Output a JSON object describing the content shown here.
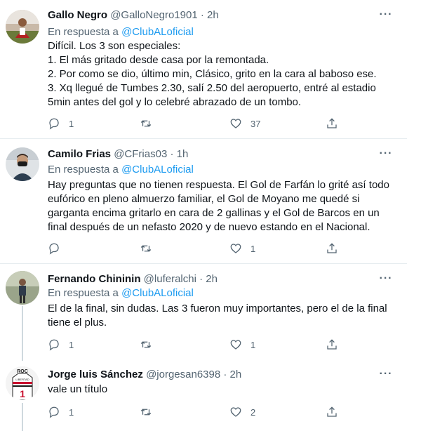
{
  "tweets": [
    {
      "name": "Gallo Negro",
      "handle": "@GalloNegro1901",
      "dot": "·",
      "time": "2h",
      "reply_prefix": "En respuesta a ",
      "reply_mention": "@ClubALoficial",
      "text": "Difícil. Los 3 son especiales:\n1. El más gritado desde casa por la remontada.\n2. Por como se dio, último min, Clásico, grito en la cara al baboso ese.\n3. Xq llegué de Tumbes 2.30, salí 2.50 del aeropuerto, entré al estadio 5min antes del gol y lo celebré abrazado de un tombo.",
      "reply_count": "1",
      "retweet_count": "",
      "like_count": "37",
      "avatar_icon": "avatar-photo-player-stadium"
    },
    {
      "name": "Camilo Frias",
      "handle": "@CFrias03",
      "dot": "·",
      "time": "1h",
      "reply_prefix": "En respuesta a ",
      "reply_mention": "@ClubALoficial",
      "text": "Hay preguntas que no tienen respuesta. El Gol de Farfán lo grité así todo eufórico en pleno almuerzo familiar, el Gol de Moyano me quedé si garganta encima gritarlo en cara de 2 gallinas y el Gol de Barcos en un final después de un nefasto 2020 y de nuevo estando en el Nacional.",
      "reply_count": "",
      "retweet_count": "",
      "like_count": "1",
      "avatar_icon": "avatar-photo-man-mask"
    },
    {
      "name": "Fernando Chininin",
      "handle": "@luferalchi",
      "dot": "·",
      "time": "2h",
      "reply_prefix": "En respuesta a ",
      "reply_mention": "@ClubALoficial",
      "text": "El de la final, sin dudas. Las 3 fueron muy importantes, pero el de la final tiene el plus.",
      "reply_count": "1",
      "retweet_count": "",
      "like_count": "1",
      "avatar_icon": "avatar-photo-person-standing"
    },
    {
      "name": "Jorge luis Sánchez",
      "handle": "@jorgesan6398",
      "dot": "·",
      "time": "2h",
      "text": "vale un título",
      "reply_count": "1",
      "retweet_count": "",
      "like_count": "2",
      "avatar_icon": "avatar-jersey-number-1",
      "avatar_badge_text": "ROC",
      "avatar_jersey_text": "LIBERTAD",
      "avatar_number": "1"
    }
  ],
  "colors": {
    "link": "#1d9bf0",
    "secondary_text": "#536471",
    "primary_text": "#0f1419",
    "divider": "#e6ecf0",
    "thread_line": "#cfd9de"
  },
  "icons": {
    "reply": "reply-icon",
    "retweet": "retweet-icon",
    "like": "heart-icon",
    "share": "share-icon",
    "more": "more-icon"
  },
  "more_glyph": "···"
}
